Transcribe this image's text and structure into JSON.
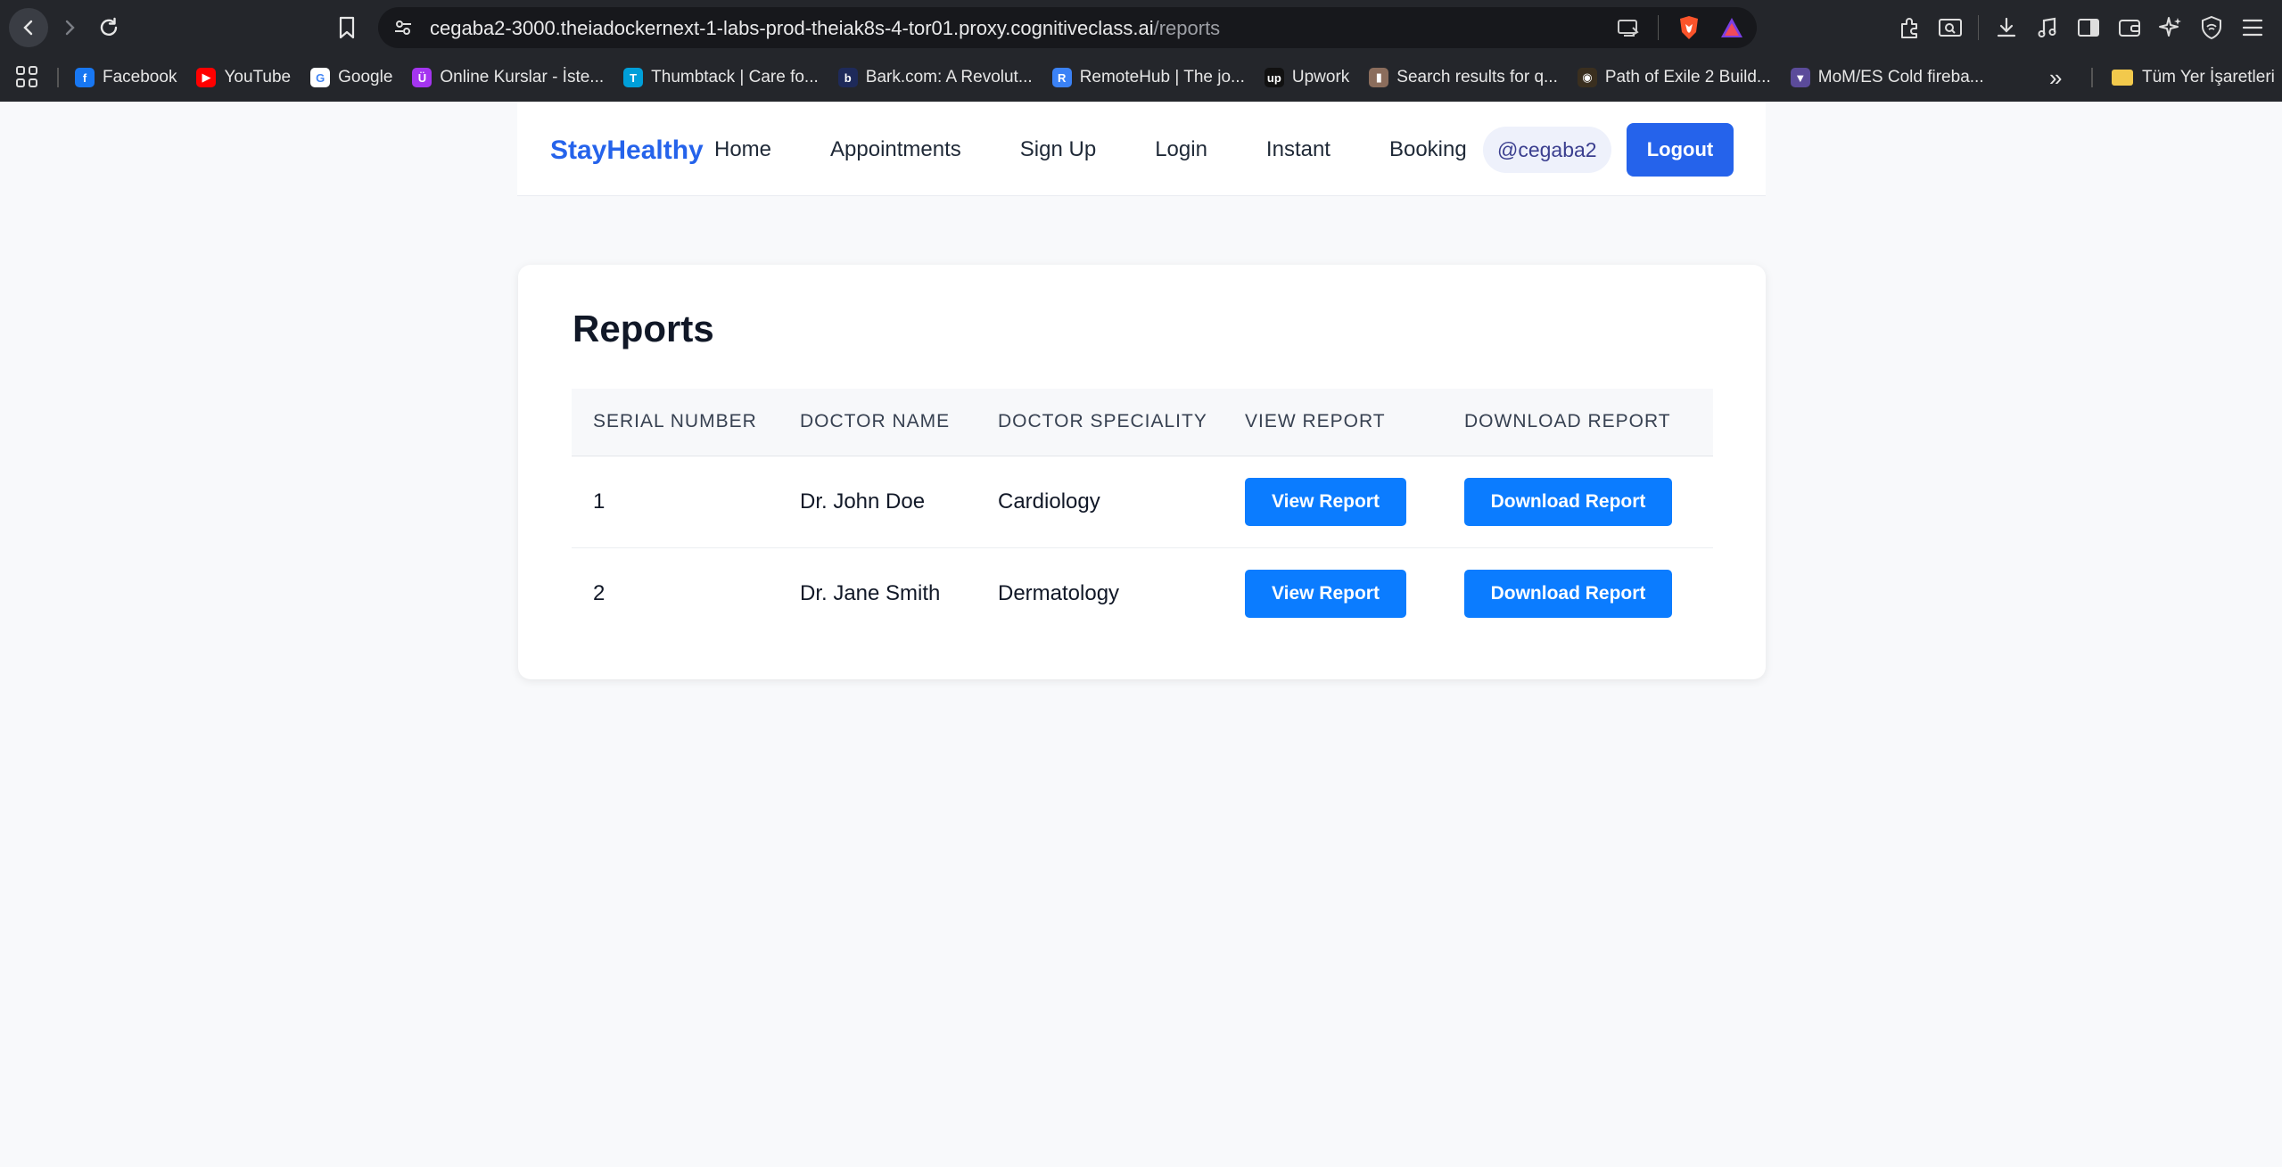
{
  "browser": {
    "url_host": "cegaba2-3000.theiadockernext-1-labs-prod-theiak8s-4-tor01.proxy.cognitiveclass.ai",
    "url_path": "/reports",
    "bookmarks": [
      {
        "label": "Facebook",
        "icon": "facebook-icon",
        "color": "#1877f2",
        "glyph": "f"
      },
      {
        "label": "YouTube",
        "icon": "youtube-icon",
        "color": "#ff0000",
        "glyph": "▶"
      },
      {
        "label": "Google",
        "icon": "google-icon",
        "color": "#ffffff",
        "glyph": "G"
      },
      {
        "label": "Online Kurslar - İste...",
        "icon": "udemy-icon",
        "color": "#a435f0",
        "glyph": "Ü"
      },
      {
        "label": "Thumbtack | Care fo...",
        "icon": "thumbtack-icon",
        "color": "#009fd9",
        "glyph": "T"
      },
      {
        "label": "Bark.com: A Revolut...",
        "icon": "bark-icon",
        "color": "#1e2a5a",
        "glyph": "b"
      },
      {
        "label": "RemoteHub | The jo...",
        "icon": "remotehub-icon",
        "color": "#3b82f6",
        "glyph": "R"
      },
      {
        "label": "Upwork",
        "icon": "upwork-icon",
        "color": "#111111",
        "glyph": "up"
      },
      {
        "label": "Search results for q...",
        "icon": "search-results-icon",
        "color": "#8b6d5c",
        "glyph": "▮"
      },
      {
        "label": "Path of Exile 2 Build...",
        "icon": "poe-icon",
        "color": "#3a2f1f",
        "glyph": "◉"
      },
      {
        "label": "MoM/ES Cold fireba...",
        "icon": "mom-icon",
        "color": "#5b4b9a",
        "glyph": "▼"
      }
    ],
    "bookmarks_folder": "Tüm Yer İşaretleri",
    "more_bookmarks": "»"
  },
  "site": {
    "brand": "StayHealthy",
    "nav": [
      "Home",
      "Appointments",
      "Sign Up",
      "Login",
      "Instant",
      "Booking"
    ],
    "username": "@cegaba2",
    "logout_label": "Logout"
  },
  "reports": {
    "title": "Reports",
    "columns": [
      "Serial Number",
      "Doctor Name",
      "Doctor Speciality",
      "View Report",
      "Download Report"
    ],
    "rows": [
      {
        "serial": "1",
        "doctor": "Dr. John Doe",
        "speciality": "Cardiology",
        "view_label": "View Report",
        "download_label": "Download Report"
      },
      {
        "serial": "2",
        "doctor": "Dr. Jane Smith",
        "speciality": "Dermatology",
        "view_label": "View Report",
        "download_label": "Download Report"
      }
    ]
  },
  "colors": {
    "brand": "#2563eb",
    "table_button": "#0b7cff",
    "chrome_bg": "#24262b"
  }
}
